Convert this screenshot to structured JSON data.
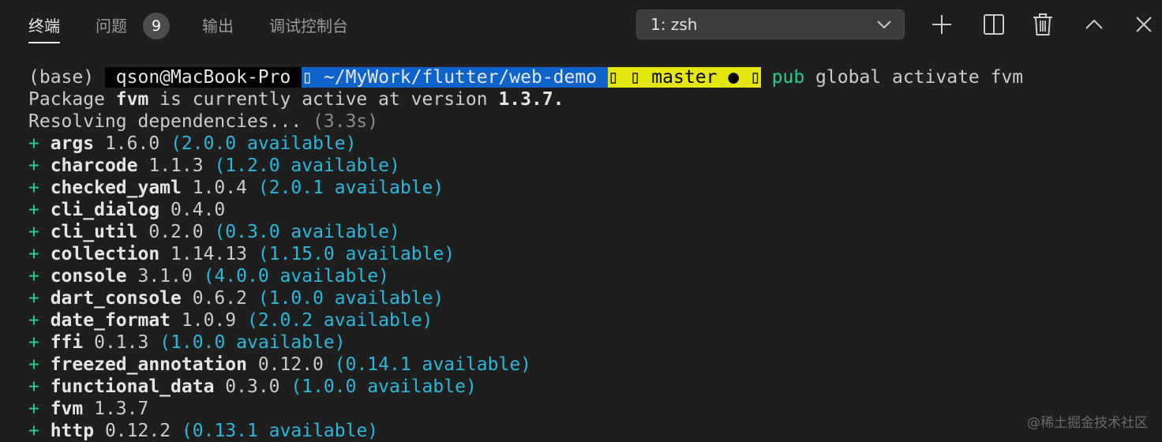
{
  "panel": {
    "tabs": [
      {
        "label": "终端"
      },
      {
        "label": "问题"
      },
      {
        "label": "输出"
      },
      {
        "label": "调试控制台"
      }
    ],
    "problems_count": "9",
    "shell_select": {
      "value": "1: zsh"
    },
    "icons": {
      "add": "plus-icon",
      "split": "split-editor-icon",
      "trash": "trash-icon",
      "maximize": "chevron-up-icon",
      "close": "close-icon"
    }
  },
  "terminal": {
    "prompt": {
      "env": "(base) ",
      "host": " qson@MacBook-Pro ",
      "path": "▯ ~/MyWork/flutter/web-demo ",
      "git": "▯ ▯ master ● ▯",
      "cmd_name": "pub",
      "cmd_args": " global activate fvm"
    },
    "active_line": {
      "prefix": "Package ",
      "pkg": "fvm",
      "middle": " is currently active at version ",
      "version": "1.3.7."
    },
    "resolving": {
      "text": "Resolving dependencies... ",
      "time": "(3.3s)"
    },
    "packages": [
      {
        "name": "args",
        "version": "1.6.0",
        "available": "(2.0.0 available)"
      },
      {
        "name": "charcode",
        "version": "1.1.3",
        "available": "(1.2.0 available)"
      },
      {
        "name": "checked_yaml",
        "version": "1.0.4",
        "available": "(2.0.1 available)"
      },
      {
        "name": "cli_dialog",
        "version": "0.4.0",
        "available": ""
      },
      {
        "name": "cli_util",
        "version": "0.2.0",
        "available": "(0.3.0 available)"
      },
      {
        "name": "collection",
        "version": "1.14.13",
        "available": "(1.15.0 available)"
      },
      {
        "name": "console",
        "version": "3.1.0",
        "available": "(4.0.0 available)"
      },
      {
        "name": "dart_console",
        "version": "0.6.2",
        "available": "(1.0.0 available)"
      },
      {
        "name": "date_format",
        "version": "1.0.9",
        "available": "(2.0.2 available)"
      },
      {
        "name": "ffi",
        "version": "0.1.3",
        "available": "(1.0.0 available)"
      },
      {
        "name": "freezed_annotation",
        "version": "0.12.0",
        "available": "(0.14.1 available)"
      },
      {
        "name": "functional_data",
        "version": "0.3.0",
        "available": "(1.0.0 available)"
      },
      {
        "name": "fvm",
        "version": "1.3.7",
        "available": ""
      },
      {
        "name": "http",
        "version": "0.12.2",
        "available": "(0.13.1 available)"
      }
    ]
  },
  "watermark": "@稀土掘金技术社区",
  "colors": {
    "background": "#1e1e1e",
    "path_segment": "#0d63c9",
    "git_segment": "#e5e510",
    "available_text": "#29b8db",
    "plus_and_command": "#23d18b"
  }
}
